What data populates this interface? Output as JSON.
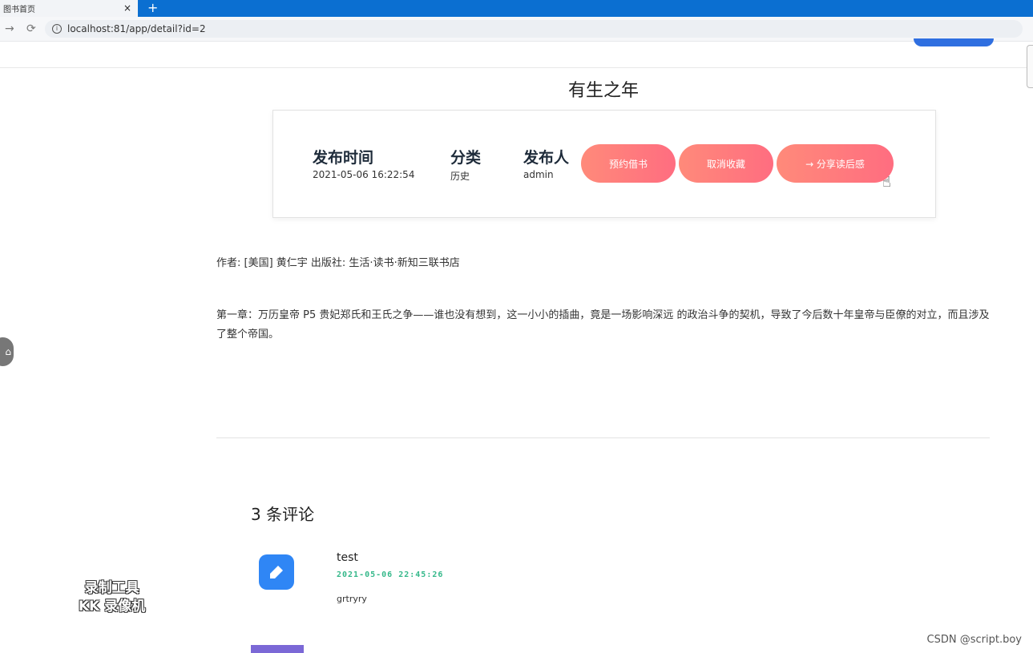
{
  "browser": {
    "tab_title": "图书首页",
    "tab_close": "×",
    "new_tab": "+",
    "url": "localhost:81/app/detail?id=2",
    "back_icon": "→",
    "reload_icon": "C"
  },
  "book": {
    "title": "有生之年",
    "publish_time_label": "发布时间",
    "publish_time": "2021-05-06 16:22:54",
    "category_label": "分类",
    "category": "历史",
    "publisher_label": "发布人",
    "publisher": "admin"
  },
  "actions": {
    "reserve": "预约借书",
    "unfavorite": "取消收藏",
    "share": "→ 分享读后感"
  },
  "content": {
    "author_line": "作者: [美国] 黄仁宇 出版社: 生活·读书·新知三联书店",
    "chapter": "第一章：万历皇帝 P5 贵妃郑氏和王氏之争——谁也没有想到，这一小小的插曲，竟是一场影响深远 的政治斗争的契机，导致了今后数十年皇帝与臣僚的对立，而且涉及了整个帝国。"
  },
  "comments": {
    "count_label": "3 条评论",
    "items": [
      {
        "user": "test",
        "time": "2021-05-06 22:45:26",
        "text": "grtryry"
      }
    ]
  },
  "overlays": {
    "recorder_line1": "录制工具",
    "recorder_line2": "KK 录像机",
    "csdn": "CSDN @script.boy",
    "side_float_icon": "⌂"
  },
  "colors": {
    "button_gradient_start": "#ff8a7a",
    "button_gradient_end": "#ff6d80",
    "avatar_blue": "#2f86f5",
    "timestamp_green": "#35b88a"
  }
}
